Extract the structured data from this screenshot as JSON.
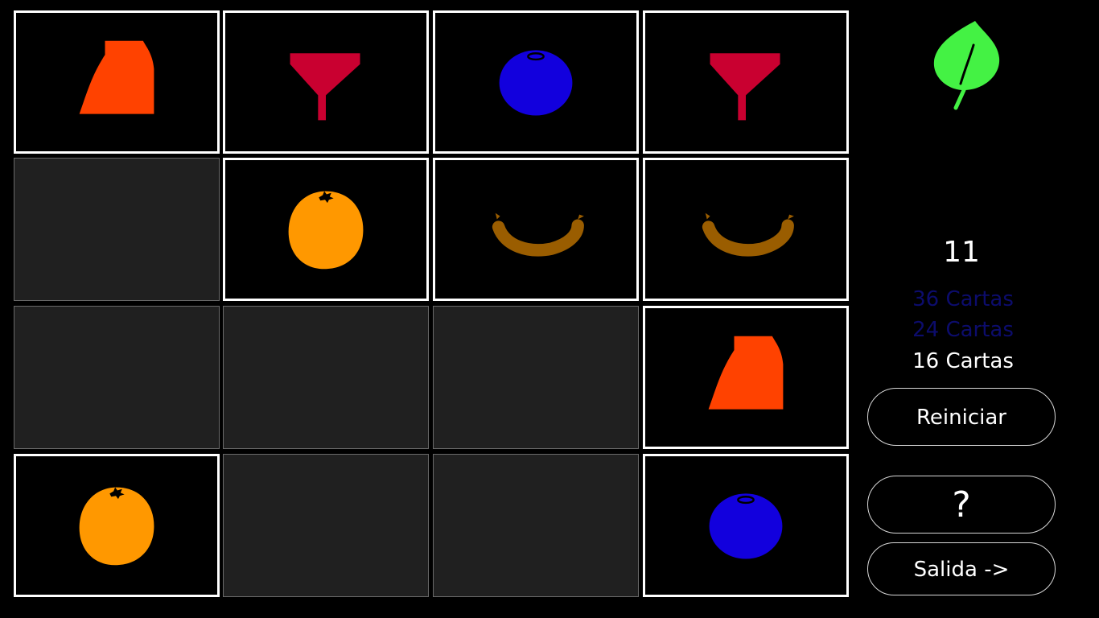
{
  "game": {
    "score": "11",
    "size_options": [
      {
        "label": "36 Cartas",
        "selected": false
      },
      {
        "label": "24 Cartas",
        "selected": false
      },
      {
        "label": "16 Cartas",
        "selected": true
      }
    ],
    "buttons": {
      "restart": "Reiniciar",
      "help": "?",
      "exit": "Salida ->"
    },
    "logo_icon": "leaf-icon",
    "colors": {
      "logo": "#44f244",
      "inactive_option": "#0c0c6c",
      "card_back": "#202020",
      "card_border": "#ffffff"
    }
  },
  "cards": [
    {
      "row": 1,
      "col": 1,
      "state": "face-up",
      "item": "skirt"
    },
    {
      "row": 1,
      "col": 2,
      "state": "face-up",
      "item": "funnel"
    },
    {
      "row": 1,
      "col": 3,
      "state": "face-up",
      "item": "blueberry"
    },
    {
      "row": 1,
      "col": 4,
      "state": "face-up",
      "item": "funnel"
    },
    {
      "row": 2,
      "col": 1,
      "state": "face-down",
      "item": null
    },
    {
      "row": 2,
      "col": 2,
      "state": "face-up",
      "item": "orange"
    },
    {
      "row": 2,
      "col": 3,
      "state": "face-up",
      "item": "sausage"
    },
    {
      "row": 2,
      "col": 4,
      "state": "face-up",
      "item": "sausage"
    },
    {
      "row": 3,
      "col": 1,
      "state": "face-down",
      "item": null
    },
    {
      "row": 3,
      "col": 2,
      "state": "face-down",
      "item": null
    },
    {
      "row": 3,
      "col": 3,
      "state": "face-down",
      "item": null
    },
    {
      "row": 3,
      "col": 4,
      "state": "face-up",
      "item": "skirt"
    },
    {
      "row": 4,
      "col": 1,
      "state": "face-up",
      "item": "orange"
    },
    {
      "row": 4,
      "col": 2,
      "state": "face-down",
      "item": null
    },
    {
      "row": 4,
      "col": 3,
      "state": "face-down",
      "item": null
    },
    {
      "row": 4,
      "col": 4,
      "state": "face-up",
      "item": "blueberry"
    }
  ]
}
